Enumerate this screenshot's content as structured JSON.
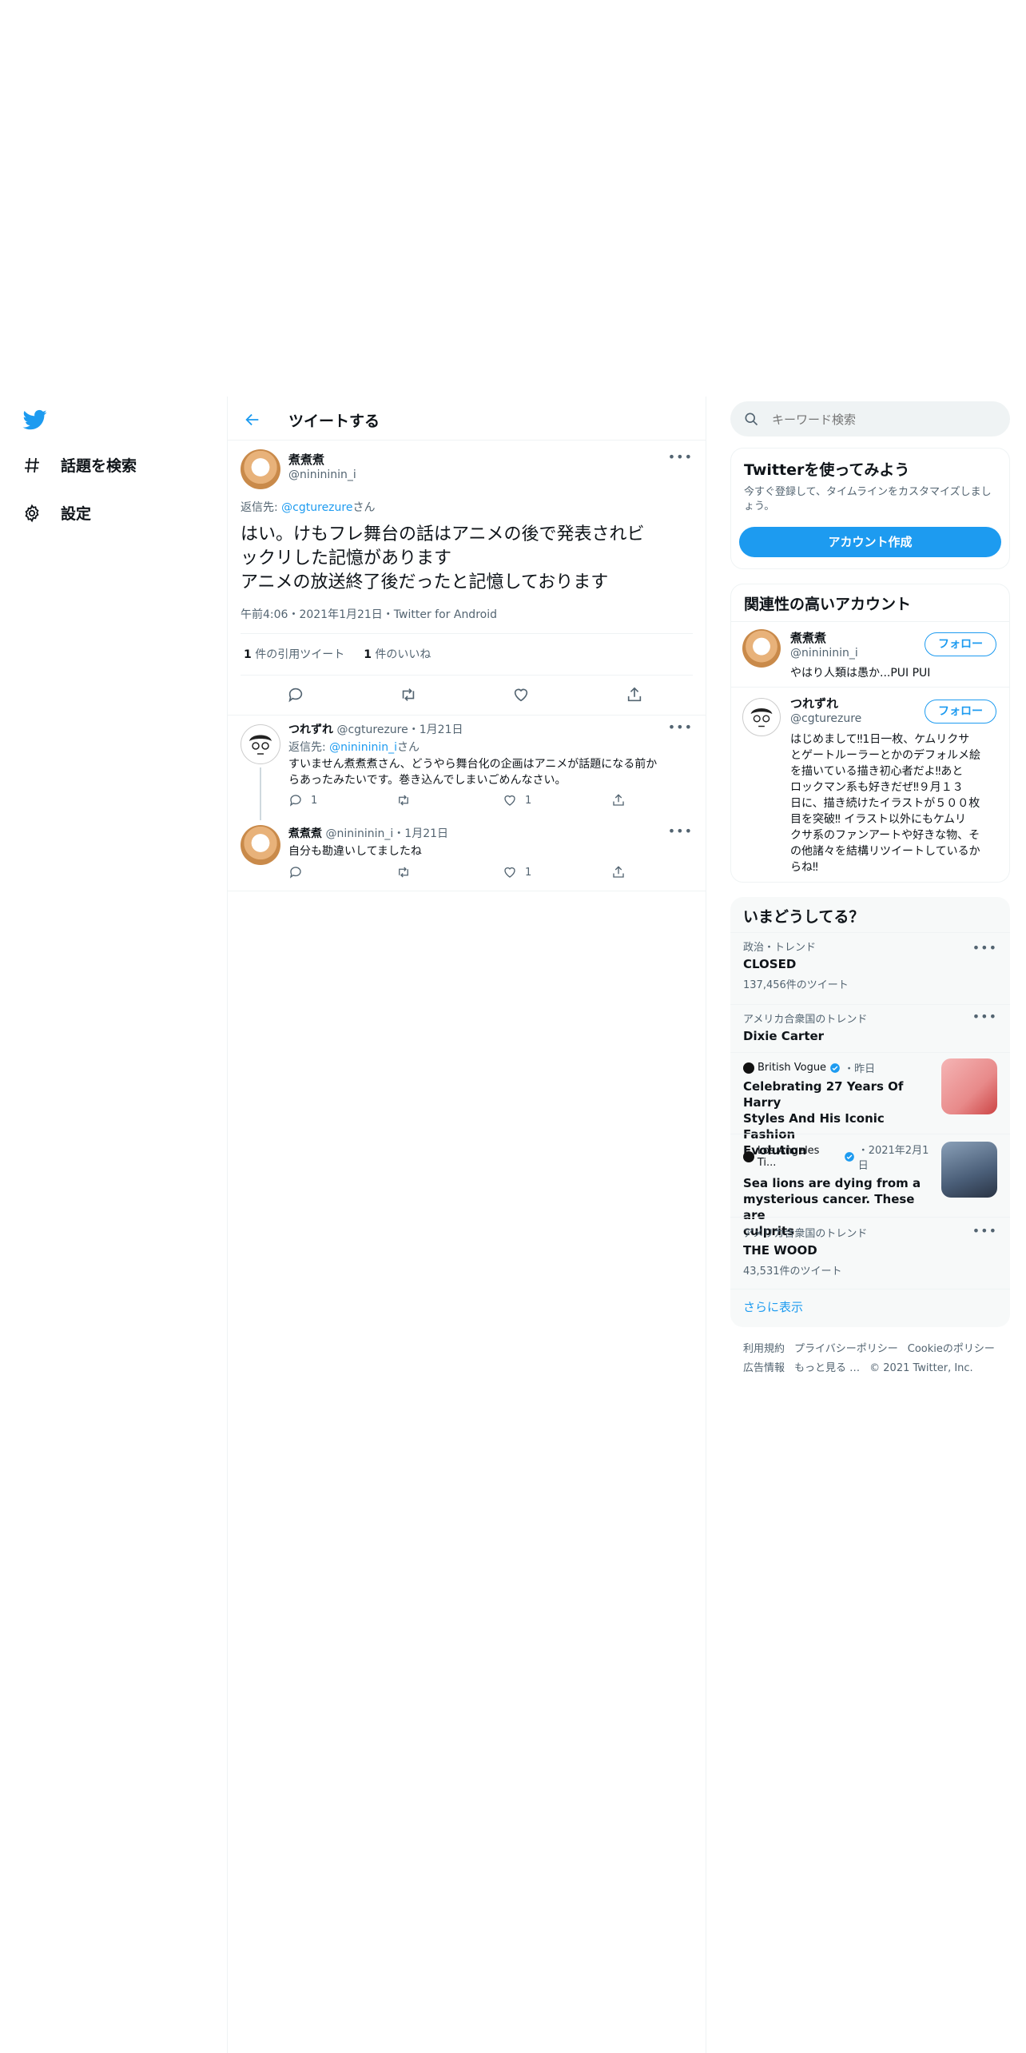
{
  "nav": {
    "items": [
      {
        "label": "話題を検索",
        "icon": "hashtag-icon"
      },
      {
        "label": "設定",
        "icon": "gear-icon"
      }
    ]
  },
  "header": {
    "title": "ツイートする"
  },
  "main_tweet": {
    "display_name": "煮煮煮",
    "handle": "@ninininin_i",
    "reply_prefix": "返信先: ",
    "reply_to": "@cgturezure",
    "reply_suffix": "さん",
    "text_line1": "はい。けもフレ舞台の話はアニメの後で発表されビ",
    "text_line2": "ックリした記憶があります",
    "text_line3": "アニメの放送終了後だったと記憶しております",
    "timestamp": "午前4:06・2021年1月21日・Twitter for Android",
    "quote_count": "1",
    "quote_label": " 件の引用ツイート",
    "like_count": "1",
    "like_label": " 件のいいね"
  },
  "replies": [
    {
      "display_name": "つれずれ",
      "handle": "@cgturezure",
      "date": "・1月21日",
      "reply_prefix": "返信先: ",
      "reply_to": "@ninininin_i",
      "reply_suffix": "さん",
      "text_line1": "すいません煮煮煮さん、どうやら舞台化の企画はアニメが話題になる前か",
      "text_line2": "らあったみたいです。巻き込んでしまいごめんなさい。",
      "reply_count": "1",
      "like_count": "1"
    },
    {
      "display_name": "煮煮煮",
      "handle": "@ninininin_i",
      "date": "・1月21日",
      "text": "自分も勘違いしてましたね",
      "like_count": "1"
    }
  ],
  "search": {
    "placeholder": "キーワード検索"
  },
  "signup": {
    "title": "Twitterを使ってみよう",
    "description": "今すぐ登録して、タイムラインをカスタマイズしましょう。",
    "button": "アカウント作成"
  },
  "related": {
    "title": "関連性の高いアカウント",
    "follow_label": "フォロー",
    "accounts": [
      {
        "name": "煮煮煮",
        "handle": "@ninininin_i",
        "bio": "やはり人類は愚か...PUI PUI"
      },
      {
        "name": "つれずれ",
        "handle": "@cgturezure",
        "bio_lines": [
          "はじめまして‼1日一枚、ケムリクサ",
          "とゲートルーラーとかのデフォルメ絵",
          "を描いている描き初心者だよ‼あと",
          "ロックマン系も好きだぜ‼９月１３",
          "日に、描き続けたイラストが５００枚",
          "目を突破‼ イラスト以外にもケムリ",
          "クサ系のファンアートや好きな物、そ",
          "の他諸々を結構リツイートしているか",
          "らね‼"
        ]
      }
    ]
  },
  "trends": {
    "title": "いまどうしてる？",
    "items": [
      {
        "meta": "政治・トレンド",
        "name": "CLOSED",
        "count": "137,456件のツイート"
      },
      {
        "meta": "アメリカ合衆国のトレンド",
        "name": "Dixie Carter"
      },
      {
        "source": "British Vogue",
        "date": "・昨日",
        "name_lines": [
          "Celebrating 27 Years Of Harry",
          "Styles And His Iconic Fashion",
          "Evolution"
        ]
      },
      {
        "source": "Los Angeles Ti...",
        "date": "・2021年2月1日",
        "name_lines": [
          "Sea lions are dying from a",
          "mysterious cancer. These are",
          "culprits"
        ]
      },
      {
        "meta": "アメリカ合衆国のトレンド",
        "name": "THE WOOD",
        "count": "43,531件のツイート"
      }
    ],
    "show_more": "さらに表示"
  },
  "footer": {
    "links_row1": [
      "利用規約",
      "プライバシーポリシー",
      "Cookieのポリシー"
    ],
    "links_row2": [
      "広告情報",
      "もっと見る …"
    ],
    "copyright": "© 2021 Twitter, Inc."
  },
  "colors": {
    "accent": "#1d9bf0",
    "text": "#0f1419",
    "muted": "#536471",
    "alert": "#e0245e"
  }
}
